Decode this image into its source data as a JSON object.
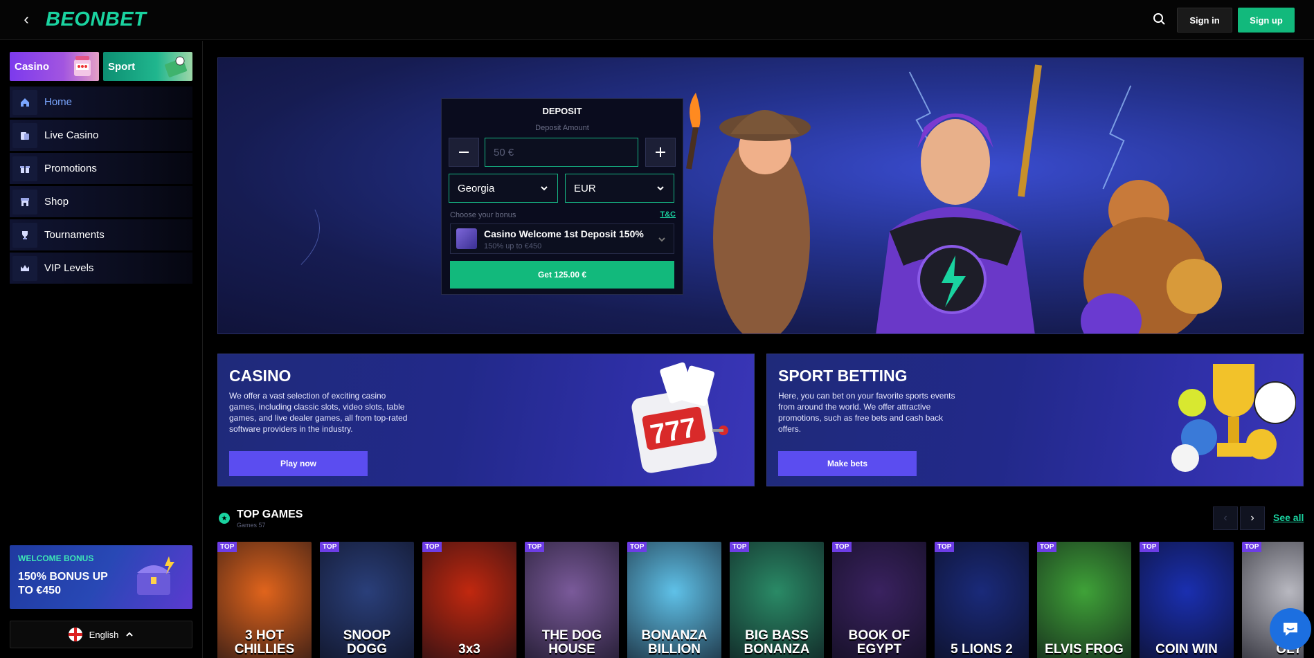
{
  "header": {
    "logo_text": "BEONBET",
    "signin_label": "Sign in",
    "signup_label": "Sign up"
  },
  "sidebar": {
    "tabs": [
      {
        "label": "Casino"
      },
      {
        "label": "Sport"
      }
    ],
    "items": [
      {
        "label": "Home",
        "icon": "home-icon"
      },
      {
        "label": "Live Casino",
        "icon": "live-casino-icon"
      },
      {
        "label": "Promotions",
        "icon": "gift-icon"
      },
      {
        "label": "Shop",
        "icon": "shop-icon"
      },
      {
        "label": "Tournaments",
        "icon": "trophy-icon"
      },
      {
        "label": "VIP Levels",
        "icon": "crown-icon"
      }
    ],
    "welcome": {
      "small": "WELCOME BONUS",
      "big": "150% BONUS UP TO €450"
    },
    "language": "English"
  },
  "deposit": {
    "title": "DEPOSIT",
    "subtitle": "Deposit Amount",
    "amount_placeholder": "50 €",
    "country": "Georgia",
    "currency": "EUR",
    "bonus_label": "Choose your bonus",
    "tc_label": "T&C",
    "bonus_name": "Casino Welcome 1st Deposit 150%",
    "bonus_desc": "150% up to €450",
    "cta_label": "Get 125.00 €"
  },
  "promos": {
    "casino": {
      "title": "CASINO",
      "text": "We offer a vast selection of exciting casino games, including classic slots, video slots, table games, and live dealer games, all from top-rated software providers in the industry.",
      "button": "Play now"
    },
    "sport": {
      "title": "SPORT BETTING",
      "text": "Here, you can bet on your favorite sports events from around the world. We offer attractive promotions, such as free bets and cash back offers.",
      "button": "Make bets"
    }
  },
  "top_games": {
    "title": "TOP GAMES",
    "subtitle": "Games 57",
    "see_all": "See all",
    "badge": "TOP",
    "games": [
      {
        "name": "3 HOT CHILLIES",
        "bg": "#e0641c"
      },
      {
        "name": "SNOOP DOGG",
        "bg": "#2a3f7a"
      },
      {
        "name": "3x3",
        "bg": "#c1280f"
      },
      {
        "name": "THE DOG HOUSE",
        "bg": "#7a5a9a"
      },
      {
        "name": "BONANZA BILLION",
        "bg": "#5fc1e8"
      },
      {
        "name": "BIG BASS BONANZA",
        "bg": "#2a8a66"
      },
      {
        "name": "BOOK OF EGYPT",
        "bg": "#3a2260"
      },
      {
        "name": "5 LIONS 2",
        "bg": "#1a2a7a"
      },
      {
        "name": "ELVIS FROG",
        "bg": "#3fa238"
      },
      {
        "name": "COIN WIN",
        "bg": "#1a2fb0"
      },
      {
        "name": "OLY",
        "bg": "#b8b8c0"
      }
    ]
  },
  "colors": {
    "accent": "#12b97c",
    "brand": "#1ad3a0",
    "promo_button": "#5b4df0"
  }
}
